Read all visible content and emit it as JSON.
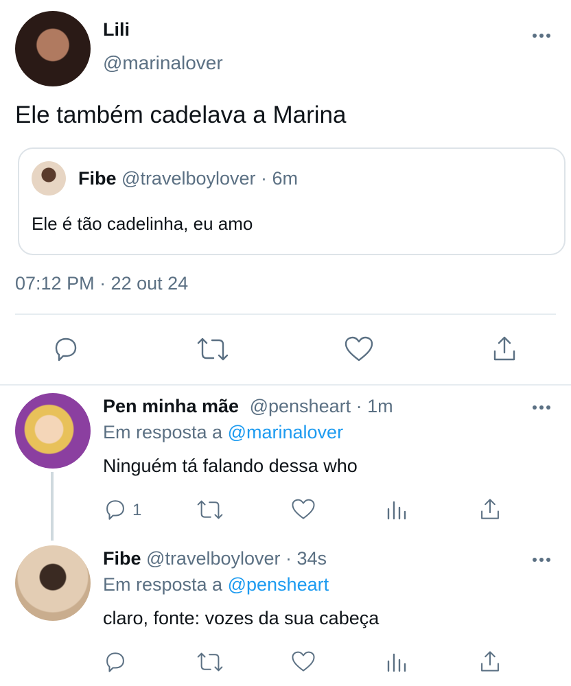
{
  "tweet": {
    "display_name": "Lili",
    "handle": "@marinalover",
    "text": "Ele também cadelava a Marina",
    "timestamp": "07:12 PM · 22 out 24",
    "quote": {
      "display_name": "Fibe",
      "handle_time": "@travelboylover · 6m",
      "text": "Ele é tão cadelinha, eu amo"
    },
    "actions": [
      "reply-icon",
      "retweet-icon",
      "like-icon",
      "share-icon"
    ]
  },
  "replies": [
    {
      "display_name": "Pen minha mãe",
      "handle_time": "@pensheart · 1m",
      "reply_prefix": "Em resposta a",
      "reply_to": "@marinalover",
      "text": "Ninguém tá falando dessa who",
      "reply_count": "1"
    },
    {
      "display_name": "Fibe",
      "handle_time": "@travelboylover · 34s",
      "reply_prefix": "Em resposta a",
      "reply_to": "@pensheart",
      "text": "claro, fonte: vozes da sua cabeça",
      "reply_count": ""
    }
  ],
  "colors": {
    "text": "#0f1419",
    "secondary": "#5b7083",
    "link": "#1d9bf0",
    "divider": "#e6ecf0"
  }
}
